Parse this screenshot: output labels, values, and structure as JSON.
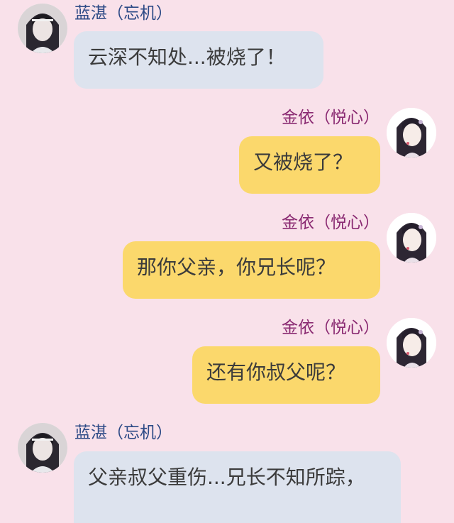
{
  "messages": [
    {
      "sender": "蓝湛（忘机）",
      "side": "left",
      "text": "云深不知处...被烧了！"
    },
    {
      "sender": "金依（悦心）",
      "side": "right",
      "text": "又被烧了？"
    },
    {
      "sender": "金依（悦心）",
      "side": "right",
      "text": "那你父亲，你兄长呢？"
    },
    {
      "sender": "金依（悦心）",
      "side": "right",
      "text": "还有你叔父呢？"
    },
    {
      "sender": "蓝湛（忘机）",
      "side": "left",
      "text": "父亲叔父重伤...兄长不知所踪，"
    }
  ],
  "colors": {
    "background": "#f9e1ea",
    "left_bubble": "#dde3ee",
    "right_bubble": "#fbd86c",
    "left_name": "#2d4a86",
    "right_name": "#8a2a72"
  },
  "icons": {
    "left_avatar": "lan-zhan-avatar-icon",
    "right_avatar": "jin-yi-avatar-icon"
  }
}
